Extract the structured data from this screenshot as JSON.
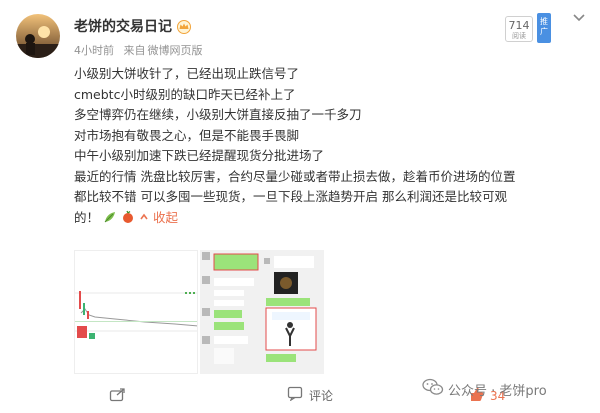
{
  "post": {
    "username": "老饼的交易日记",
    "time": "4小时前",
    "source_prefix": "来自",
    "source": "微博网页版",
    "read_count": "714",
    "read_label": "阅读",
    "ad_label": "推广",
    "lines": [
      "小级别大饼收针了，已经出现止跌信号了",
      "cmebtc小时级别的缺口昨天已经补上了",
      "多空博弈仍在继续，小级别大饼直接反抽了一千多刀",
      "对市场抱有敬畏之心，但是不能畏手畏脚",
      "中午小级别加速下跌已经提醒现货分批进场了"
    ],
    "para_line1": "最近的行情 洗盘比较厉害，合约尽量少碰或者带止损去做，趁着币价进场的位置",
    "para_line2": "都比较不错 可以多囤一些现货，一旦下段上涨趋势开启 那么利润还是比较可观",
    "para_line3_prefix": "的！",
    "collapse_label": "收起"
  },
  "footer": {
    "comment_label": "评论",
    "like_count": "34"
  },
  "watermark": {
    "text": "公众号 · 老饼pro"
  }
}
